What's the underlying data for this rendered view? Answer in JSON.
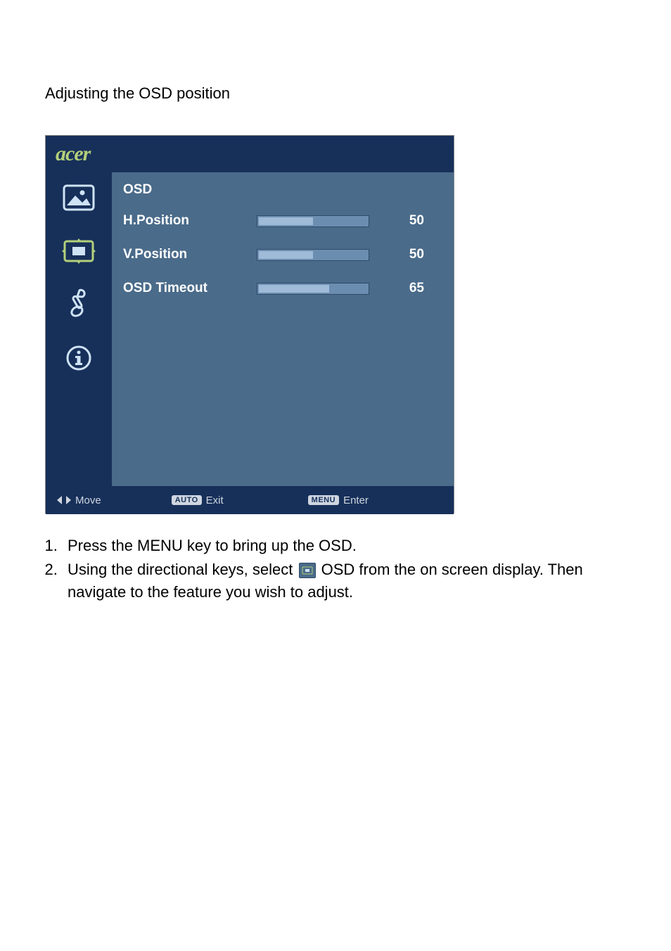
{
  "page_title": "Adjusting the OSD position",
  "osd": {
    "brand": "acer",
    "section_title": "OSD",
    "rows": [
      {
        "label": "H.Position",
        "value": "50",
        "fill_pct": 50
      },
      {
        "label": "V.Position",
        "value": "50",
        "fill_pct": 50
      },
      {
        "label": "OSD Timeout",
        "value": "65",
        "fill_pct": 65
      }
    ],
    "footer": {
      "move_label": "Move",
      "auto_badge": "AUTO",
      "exit_label": "Exit",
      "menu_badge": "MENU",
      "enter_label": "Enter"
    }
  },
  "instructions": {
    "item1": "Press the MENU key to bring up the OSD.",
    "item2_a": "Using the directional keys, select ",
    "item2_b": " OSD from the on screen display. Then navigate to the feature you wish to adjust."
  }
}
